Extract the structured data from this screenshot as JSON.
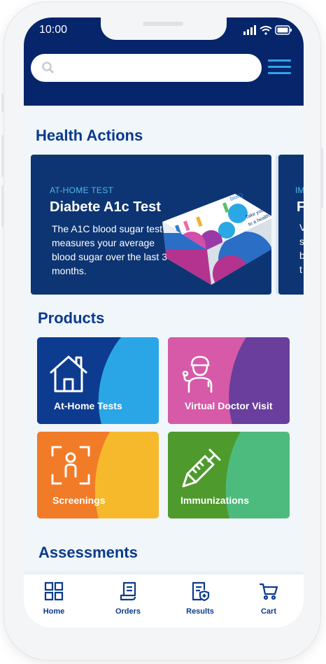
{
  "status_bar": {
    "time": "10:00"
  },
  "search": {
    "placeholder": ""
  },
  "sections": {
    "health_actions": "Health Actions",
    "products": "Products",
    "assessments": "Assessments"
  },
  "health_action_cards": [
    {
      "eyebrow": "AT-HOME TEST",
      "title": "Diabete A1c Test",
      "description": "The A1C blood sugar test measures your average blood sugar over the last 3 months."
    },
    {
      "eyebrow": "IM",
      "title": "F",
      "lines": [
        "V",
        "s",
        "b",
        "t"
      ]
    }
  ],
  "kit_box": {
    "brand": "bioIQ",
    "lines": [
      "Take your fi",
      "to a health"
    ]
  },
  "products": [
    {
      "label": "At-Home Tests",
      "icon": "house-icon"
    },
    {
      "label": "Virtual Doctor Visit",
      "icon": "doctor-icon"
    },
    {
      "label": "Screenings",
      "icon": "person-scan-icon"
    },
    {
      "label": "Immunizations",
      "icon": "syringe-icon"
    }
  ],
  "bottom_nav": [
    {
      "label": "Home",
      "icon": "grid-icon"
    },
    {
      "label": "Orders",
      "icon": "receipt-icon"
    },
    {
      "label": "Results",
      "icon": "results-shield-icon"
    },
    {
      "label": "Cart",
      "icon": "cart-icon"
    }
  ],
  "colors": {
    "header": "#06256b",
    "accent": "#2fa4e7",
    "title": "#0a3a8c",
    "card": "#0d3573"
  }
}
